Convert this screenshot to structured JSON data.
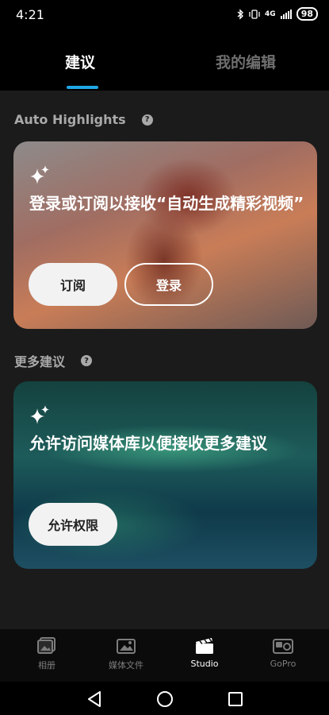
{
  "status": {
    "time": "4:21",
    "network": "4G",
    "battery": "98"
  },
  "tabs": {
    "active": "建议",
    "inactive": "我的编辑"
  },
  "section1": {
    "title": "Auto Highlights",
    "card_text": "登录或订阅以接收“自动生成精彩视频”",
    "subscribe_label": "订阅",
    "login_label": "登录"
  },
  "section2": {
    "title": "更多建议",
    "card_text": "允许访问媒体库以便接收更多建议",
    "allow_label": "允许权限"
  },
  "bottom_nav": {
    "items": [
      {
        "label": "相册",
        "icon": "album-icon"
      },
      {
        "label": "媒体文件",
        "icon": "media-icon"
      },
      {
        "label": "Studio",
        "icon": "clapperboard-icon"
      },
      {
        "label": "GoPro",
        "icon": "gopro-camera-icon"
      }
    ],
    "active_index": 2
  },
  "colors": {
    "accent": "#1fa6e6",
    "background": "#1b1b1b"
  }
}
